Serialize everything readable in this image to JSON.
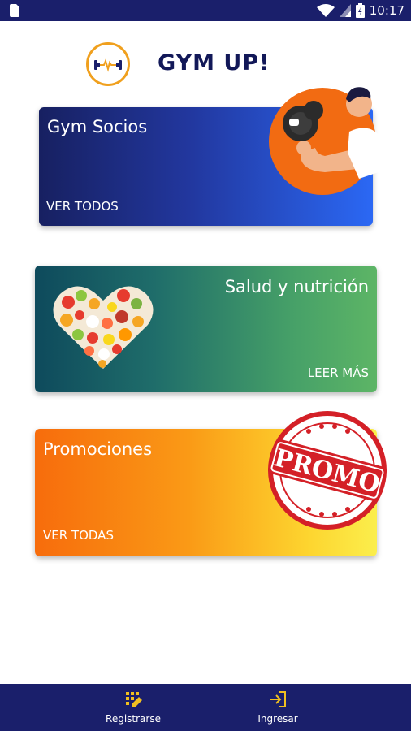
{
  "status_bar": {
    "time": "10:17",
    "icons": [
      "sim-card-icon",
      "wifi-icon",
      "cell-signal-icon",
      "battery-icon"
    ]
  },
  "header": {
    "title": "GYM UP!",
    "logo_icon": "dumbbell-heartbeat-icon"
  },
  "cards": {
    "socios": {
      "title": "Gym Socios",
      "link": "VER TODOS"
    },
    "salud": {
      "title": "Salud y nutrición",
      "link": "LEER MÁS"
    },
    "promociones": {
      "title": "Promociones",
      "link": "VER TODAS",
      "stamp_text": "PROMO"
    }
  },
  "bottom_nav": {
    "register": {
      "label": "Registrarse",
      "icon": "register-icon"
    },
    "login": {
      "label": "Ingresar",
      "icon": "login-icon"
    }
  },
  "colors": {
    "primary_dark": "#1a1f6b",
    "accent_orange": "#f0a01e",
    "title_navy": "#121858"
  }
}
